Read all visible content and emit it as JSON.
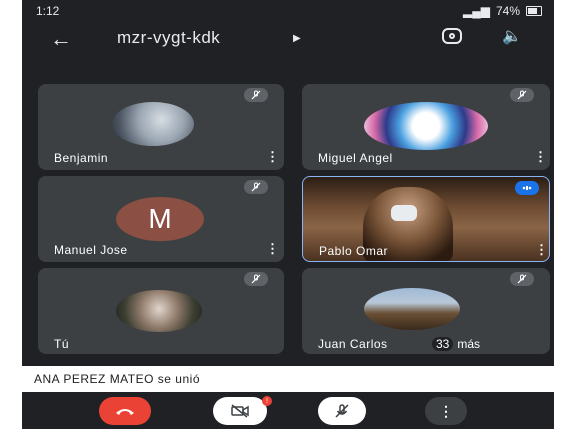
{
  "status_bar": {
    "time": "1:12",
    "battery": "74%"
  },
  "header": {
    "meeting_code": "mzr-vygt-kdk"
  },
  "participants": [
    {
      "name": "Benjamin"
    },
    {
      "name": "Miguel Angel"
    },
    {
      "name": "Manuel Jose",
      "initial": "M"
    },
    {
      "name": "Pablo Omar"
    },
    {
      "name": "Tú"
    },
    {
      "name": "Juan Carlos"
    }
  ],
  "more_participants": {
    "count": "33",
    "label": "más"
  },
  "toast": {
    "message": "ANA PEREZ MATEO se unió"
  },
  "controls": {
    "camera_badge": "!"
  },
  "colors": {
    "background": "#202124",
    "tile": "#3c4043",
    "hangup": "#ea4335",
    "avatar_letter_bg": "#8b5043"
  }
}
